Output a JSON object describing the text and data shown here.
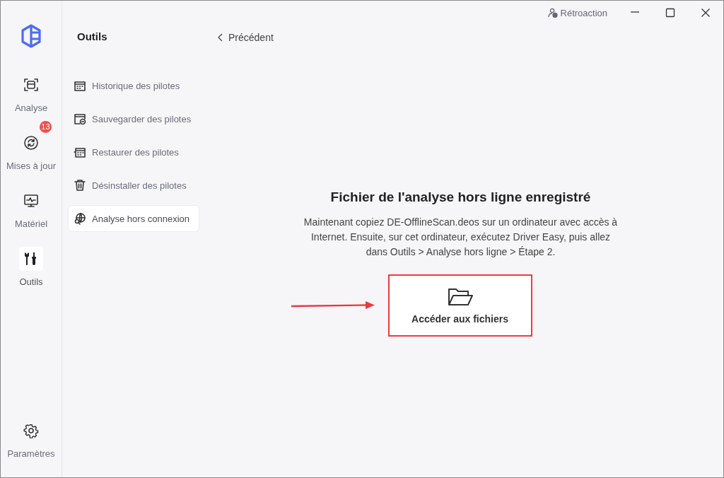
{
  "title_bar": {
    "feedback": "Rétroaction"
  },
  "nav": {
    "items": [
      {
        "kind": "scan",
        "label": "Analyse",
        "selected": false
      },
      {
        "kind": "update",
        "label": "Mises à jour",
        "selected": false,
        "badge": "13"
      },
      {
        "kind": "hardware",
        "label": "Matériel",
        "selected": false
      },
      {
        "kind": "tools",
        "label": "Outils",
        "selected": true
      }
    ],
    "settings": {
      "label": "Paramètres"
    }
  },
  "tools_panel": {
    "title": "Outils",
    "items": [
      {
        "kind": "history",
        "label": "Historique des pilotes",
        "selected": false
      },
      {
        "kind": "backup",
        "label": "Sauvegarder des pilotes",
        "selected": false
      },
      {
        "kind": "restore",
        "label": "Restaurer des pilotes",
        "selected": false
      },
      {
        "kind": "uninstall",
        "label": "Désinstaller des pilotes",
        "selected": false
      },
      {
        "kind": "offline",
        "label": "Analyse hors connexion",
        "selected": true
      }
    ]
  },
  "main": {
    "back": "Précédent",
    "heading": "Fichier de l'analyse hors ligne enregistré",
    "message": "Maintenant copiez DE-OfflineScan.deos sur un ordinateur avec accès à Internet. Ensuite, sur cet ordinateur, exécutez Driver Easy, puis allez dans Outils > Analyse hors ligne > Étape 2.",
    "button": {
      "label": "Accéder aux fichiers",
      "highlighted": true
    }
  }
}
